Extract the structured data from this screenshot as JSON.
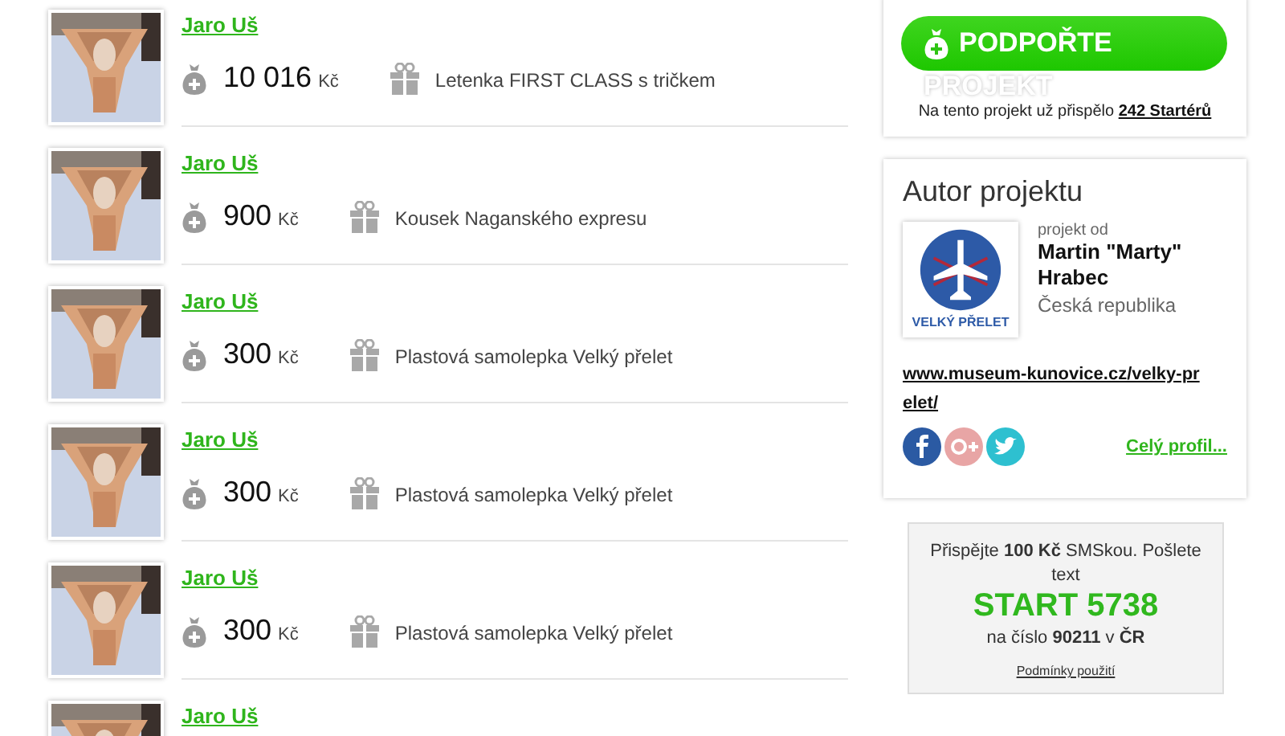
{
  "backers": [
    {
      "name": "Jaro Uš",
      "amount": "10 016",
      "currency": "Kč",
      "reward": "Letenka FIRST CLASS s tričkem"
    },
    {
      "name": "Jaro Uš",
      "amount": "900",
      "currency": "Kč",
      "reward": "Kousek Naganského expresu"
    },
    {
      "name": "Jaro Uš",
      "amount": "300",
      "currency": "Kč",
      "reward": "Plastová samolepka Velký přelet"
    },
    {
      "name": "Jaro Uš",
      "amount": "300",
      "currency": "Kč",
      "reward": "Plastová samolepka Velký přelet"
    },
    {
      "name": "Jaro Uš",
      "amount": "300",
      "currency": "Kč",
      "reward": "Plastová samolepka Velký přelet"
    },
    {
      "name": "Jaro Uš"
    }
  ],
  "support": {
    "button": "PODPOŘTE",
    "subtitle": "PROJEKT",
    "note": "Na tento projekt už přispělo",
    "backers_link": "242 Startérů"
  },
  "author": {
    "heading": "Autor projektu",
    "logo_text": "VELKÝ PŘELET",
    "by": "projekt od",
    "name": "Martin \"Marty\" Hrabec",
    "country": "Česká republika",
    "website": "www.museum-kunovice.cz/velky-prelet/",
    "profile_link": "Celý profil..."
  },
  "sms": {
    "intro": "Přispějte **100 Kč** SMSkou. Pošlete text",
    "code": "START 5738",
    "number": "na číslo **90211** v **ČR**",
    "terms": "Podmínky použití"
  }
}
